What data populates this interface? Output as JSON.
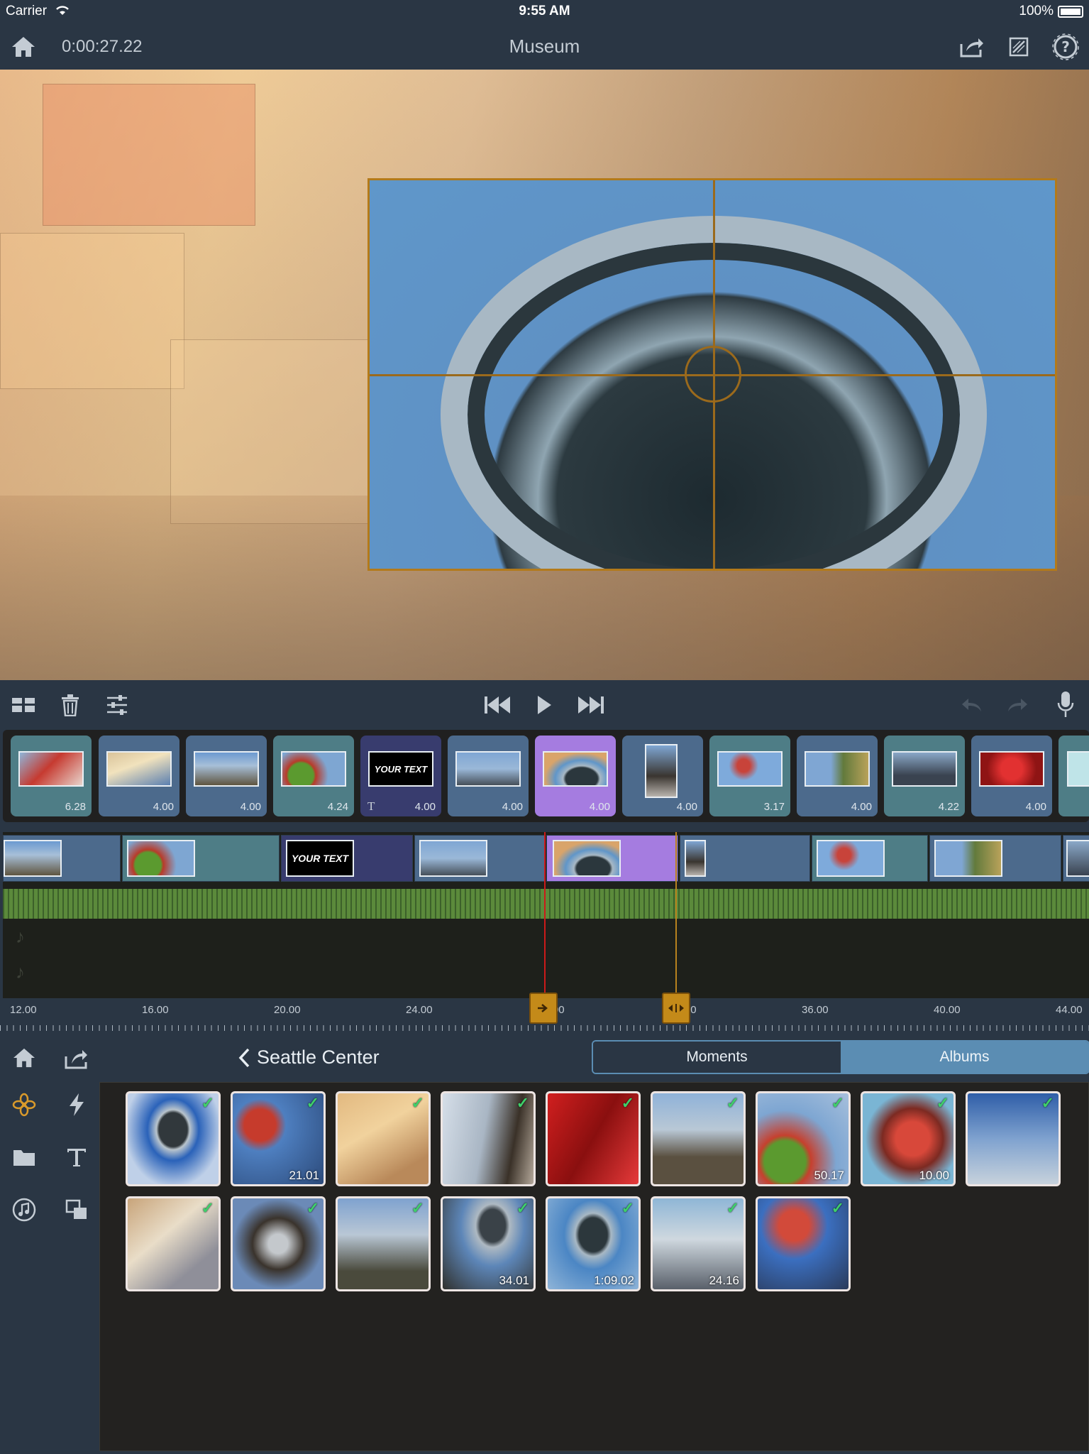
{
  "status_bar": {
    "carrier": "Carrier",
    "time": "9:55 AM",
    "battery": "100%"
  },
  "header": {
    "timecode": "0:00:27.22",
    "title": "Museum"
  },
  "storyboard": {
    "clips": [
      {
        "duration": "6.28",
        "style": "teal"
      },
      {
        "duration": "4.00",
        "style": "blue"
      },
      {
        "duration": "4.00",
        "style": "blue"
      },
      {
        "duration": "4.24",
        "style": "teal"
      },
      {
        "duration": "4.00",
        "style": "navy",
        "title_text": "YOUR TEXT",
        "title_marker": "T"
      },
      {
        "duration": "4.00",
        "style": "blue"
      },
      {
        "duration": "4.00",
        "style": "selected"
      },
      {
        "duration": "4.00",
        "style": "blue"
      },
      {
        "duration": "3.17",
        "style": "teal"
      },
      {
        "duration": "4.00",
        "style": "blue"
      },
      {
        "duration": "4.22",
        "style": "teal"
      },
      {
        "duration": "4.00",
        "style": "blue"
      }
    ]
  },
  "timeline": {
    "title_text": "YOUR TEXT"
  },
  "ruler": {
    "labels": [
      "12.00",
      "16.00",
      "20.00",
      "24.00",
      "28.00",
      "32.00",
      "36.00",
      "40.00",
      "44.00"
    ]
  },
  "library": {
    "back_label": "Seattle Center",
    "tabs": {
      "moments": "Moments",
      "albums": "Albums"
    },
    "check_glyph": "✓",
    "items": [
      {
        "duration": "",
        "checked": true
      },
      {
        "duration": "21.01",
        "checked": true
      },
      {
        "duration": "",
        "checked": true
      },
      {
        "duration": "",
        "checked": true
      },
      {
        "duration": "",
        "checked": true
      },
      {
        "duration": "",
        "checked": true
      },
      {
        "duration": "50.17",
        "checked": true
      },
      {
        "duration": "10.00",
        "checked": true
      },
      {
        "duration": "",
        "checked": true
      },
      {
        "duration": "",
        "checked": true
      },
      {
        "duration": "",
        "checked": true
      },
      {
        "duration": "",
        "checked": true
      },
      {
        "duration": "34.01",
        "checked": true
      },
      {
        "duration": "1:09.02",
        "checked": true
      },
      {
        "duration": "24.16",
        "checked": true
      },
      {
        "duration": "",
        "checked": true
      }
    ]
  },
  "colors": {
    "accent": "#5b8db3",
    "selected_clip": "#a57ce0",
    "audio": "#5b8a3b",
    "handle": "#c48a19"
  }
}
